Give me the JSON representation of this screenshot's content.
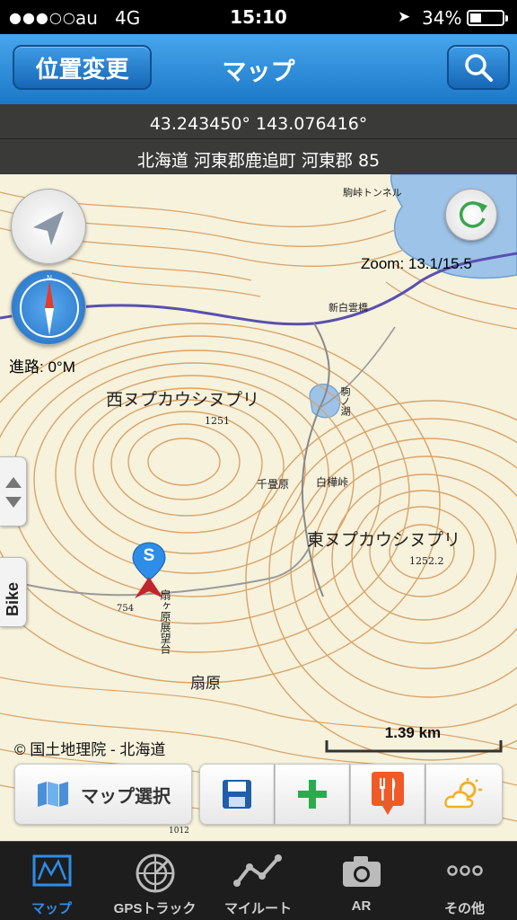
{
  "status_bar": {
    "signal": "●●●○○",
    "carrier": "au",
    "network": "4G",
    "time": "15:10",
    "battery_percent": "34%",
    "battery_level": 0.34
  },
  "nav": {
    "left_button": "位置変更",
    "title": "マップ",
    "right_icon": "search-icon"
  },
  "location": {
    "coordinates": "43.243450° 143.076416°",
    "address": "北海道 河東郡鹿追町 河東郡 85"
  },
  "map": {
    "zoom_text": "Zoom: 13.1/15.5",
    "heading_text": "進路: 0°M",
    "side_label": "Bike",
    "copyright": "© 国土地理院 - 北海道",
    "scale": "1.39 km",
    "marker_letter": "S",
    "labels": {
      "mountain_west": "西ヌプカウシヌプリ",
      "mountain_east": "東ヌプカウシヌプリ",
      "elev_west": "1251",
      "elev_east": "1252.2",
      "tunnel": "駒峠トンネル",
      "pass": "新白雲橋",
      "senjogahara": "千畳原",
      "shirakaba": "白樺峠",
      "ogihara": "扇原",
      "observatory": "扇ヶ原展望台",
      "marker_elev": "754",
      "lake_names": "駒ノ湖",
      "spot_elev": "1012"
    }
  },
  "toolbar": {
    "map_select": "マップ選択",
    "icons": [
      "save-icon",
      "add-icon",
      "restaurant-icon",
      "weather-icon"
    ]
  },
  "tabs": [
    {
      "label": "マップ",
      "icon": "map-icon",
      "active": true
    },
    {
      "label": "GPSトラック",
      "icon": "radar-icon",
      "active": false
    },
    {
      "label": "マイルート",
      "icon": "route-icon",
      "active": false
    },
    {
      "label": "AR",
      "icon": "camera-icon",
      "active": false
    },
    {
      "label": "その他",
      "icon": "more-icon",
      "active": false
    }
  ],
  "colors": {
    "nav_blue": "#2f8de0",
    "tab_active": "#2d8de8",
    "contour": "#d9a46a",
    "lake": "#9dc3e8",
    "road": "#5a4fb0"
  }
}
